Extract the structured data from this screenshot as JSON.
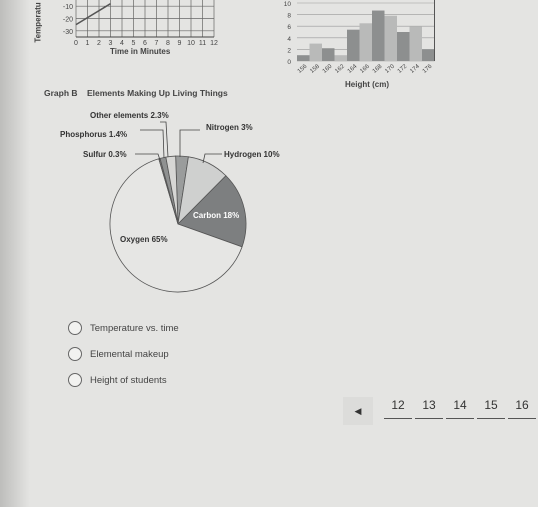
{
  "graph_a": {
    "ylabel": "Temperatu",
    "xlabel": "Time in Minutes",
    "yticks": [
      "-10",
      "-20",
      "-30"
    ],
    "xticks": [
      "0",
      "1",
      "2",
      "3",
      "4",
      "5",
      "6",
      "7",
      "8",
      "9",
      "10",
      "11",
      "12"
    ],
    "line": {
      "x": [
        0,
        3
      ],
      "y": [
        -25,
        -8
      ]
    }
  },
  "bar_graph": {
    "xlabel": "Height (cm)",
    "yticks": [
      "0",
      "2",
      "4",
      "6",
      "8",
      "10"
    ],
    "categories": [
      "156",
      "158",
      "160",
      "162",
      "164",
      "166",
      "168",
      "170",
      "172",
      "174",
      "176"
    ],
    "values": [
      1,
      3,
      2.2,
      1,
      5.4,
      6.5,
      8.7,
      7.8,
      5,
      6,
      2
    ]
  },
  "graph_b": {
    "label": "Graph B",
    "title": "Elements Making Up Living Things",
    "slices": [
      {
        "name": "Nitrogen 3%",
        "value": 3,
        "color": "#9a9c9c"
      },
      {
        "name": "Hydrogen 10%",
        "value": 10,
        "color": "#cfd0cf"
      },
      {
        "name": "Carbon 18%",
        "value": 18,
        "color": "#7d7f80"
      },
      {
        "name": "Oxygen 65%",
        "value": 65,
        "color": "#e6e6e4"
      },
      {
        "name": "Sulfur 0.3%",
        "value": 0.3,
        "color": "#888"
      },
      {
        "name": "Phosphorus 1.4%",
        "value": 1.4,
        "color": "#8f9191"
      },
      {
        "name": "Other elements 2.3%",
        "value": 2.3,
        "color": "#d6d6d4"
      }
    ]
  },
  "options": [
    "Temperature vs. time",
    "Elemental makeup",
    "Height of students"
  ],
  "pagination": {
    "prev_icon": "triangle-left-icon",
    "pages": [
      "12",
      "13",
      "14",
      "15",
      "16"
    ]
  }
}
